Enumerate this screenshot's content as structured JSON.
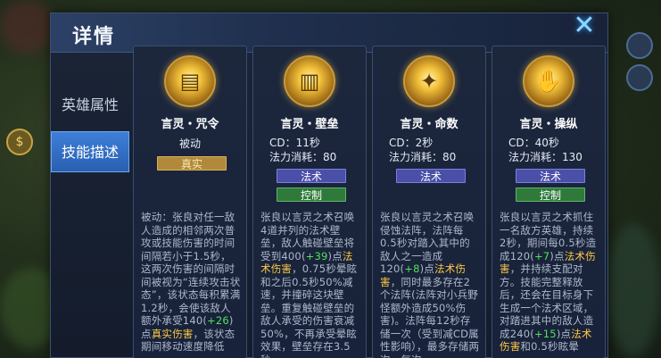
{
  "panel": {
    "title": "详情",
    "close_glyph": "✕"
  },
  "sidebar": {
    "tabs": [
      {
        "label": "英雄属性",
        "active": false
      },
      {
        "label": "技能描述",
        "active": true
      }
    ]
  },
  "left_hud": {
    "coin_glyph": "$"
  },
  "skills": [
    {
      "name": "言灵・咒令",
      "type": "被动",
      "tag": "真实",
      "desc_parts": [
        {
          "t": "被动：张良对任一敌人造成的相邻两次普攻或技能伤害的时间间隔若小于1.5秒，这两次伤害的间隔时间被视为“连续攻击状态”，该状态每积累满1.2秒，会使该敌人额外承受140(",
          "c": ""
        },
        {
          "t": "+26",
          "c": "g"
        },
        {
          "t": ")点",
          "c": ""
        },
        {
          "t": "真实伤害",
          "c": "y"
        },
        {
          "t": "，该状态期间移动速度降低",
          "c": ""
        }
      ]
    },
    {
      "name": "言灵・壁垒",
      "cd": "CD：11秒",
      "cost": "法力消耗：80",
      "tags": [
        "法术",
        "控制"
      ],
      "desc_parts": [
        {
          "t": "张良以言灵之术召唤4道并列的法术壁垒，敌人触碰壁垒将受到400(",
          "c": ""
        },
        {
          "t": "+39",
          "c": "g"
        },
        {
          "t": ")点",
          "c": ""
        },
        {
          "t": "法术伤害",
          "c": "y"
        },
        {
          "t": "，0.75秒晕眩和之后0.5秒50%减速，并撞碎这块壁垒。重复触碰壁垒的敌人承受的伤害衰减50%，不再承受晕眩效果，壁垒存在3.5秒",
          "c": ""
        }
      ]
    },
    {
      "name": "言灵・命数",
      "cd": "CD：2秒",
      "cost": "法力消耗：80",
      "tags": [
        "法术"
      ],
      "desc_parts": [
        {
          "t": "张良以言灵之术召唤侵蚀法阵，法阵每0.5秒对踏入其中的敌人之一造成120(",
          "c": ""
        },
        {
          "t": "+8",
          "c": "g"
        },
        {
          "t": ")点",
          "c": ""
        },
        {
          "t": "法术伤害",
          "c": "y"
        },
        {
          "t": "，同时最多存在2个法阵(法阵对小兵野怪额外造成50%伤害)。法阵每12秒存储一次（受到减CD属性影响），最多存储两次，每次",
          "c": ""
        }
      ]
    },
    {
      "name": "言灵・操纵",
      "cd": "CD：40秒",
      "cost": "法力消耗：130",
      "tags": [
        "法术",
        "控制"
      ],
      "desc_parts": [
        {
          "t": "张良以言灵之术抓住一名敌方英雄，持续2秒，期间每0.5秒造成120(",
          "c": ""
        },
        {
          "t": "+7",
          "c": "g"
        },
        {
          "t": ")点",
          "c": ""
        },
        {
          "t": "法术伤害",
          "c": "y"
        },
        {
          "t": "，并持续支配对方。技能完整释放后，还会在目标身下生成一个法术区域，对踏进其中的敌人造成240(",
          "c": ""
        },
        {
          "t": "+15",
          "c": "g"
        },
        {
          "t": ")点",
          "c": ""
        },
        {
          "t": "法术伤害",
          "c": "y"
        },
        {
          "t": "和0.5秒眩晕",
          "c": ""
        }
      ]
    }
  ]
}
